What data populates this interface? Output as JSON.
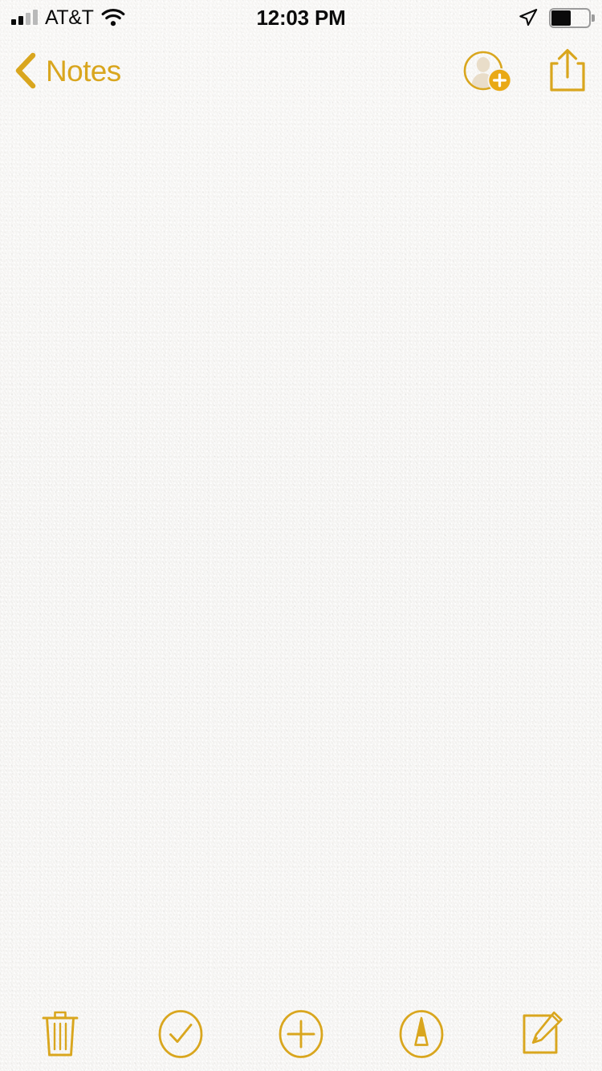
{
  "app": {
    "name": "Notes",
    "theme_accent": "#d9a61e",
    "paper_background": "#f6f5f3"
  },
  "status_bar": {
    "carrier": "AT&T",
    "time": "12:03 PM",
    "signal_icon": "cellular-signal-icon",
    "signal_bars_filled": 2,
    "signal_bars_total": 4,
    "wifi_icon": "wifi-icon",
    "location_icon": "location-arrow-icon",
    "battery_icon": "battery-icon",
    "battery_percent": 55
  },
  "nav_bar": {
    "back_label": "Notes",
    "back_icon": "chevron-left-icon",
    "add_people_icon": "add-person-icon",
    "share_icon": "share-icon",
    "ghost_title": ""
  },
  "note": {
    "content": "",
    "placeholder": ""
  },
  "toolbar": {
    "items": [
      {
        "name": "delete-button",
        "icon": "trash-icon",
        "label": "Delete"
      },
      {
        "name": "checklist-button",
        "icon": "checkmark-circle-icon",
        "label": "Checklist"
      },
      {
        "name": "add-button",
        "icon": "plus-circle-icon",
        "label": "Add"
      },
      {
        "name": "markup-button",
        "icon": "markup-pen-icon",
        "label": "Markup"
      },
      {
        "name": "compose-button",
        "icon": "compose-icon",
        "label": "New Note"
      }
    ]
  }
}
